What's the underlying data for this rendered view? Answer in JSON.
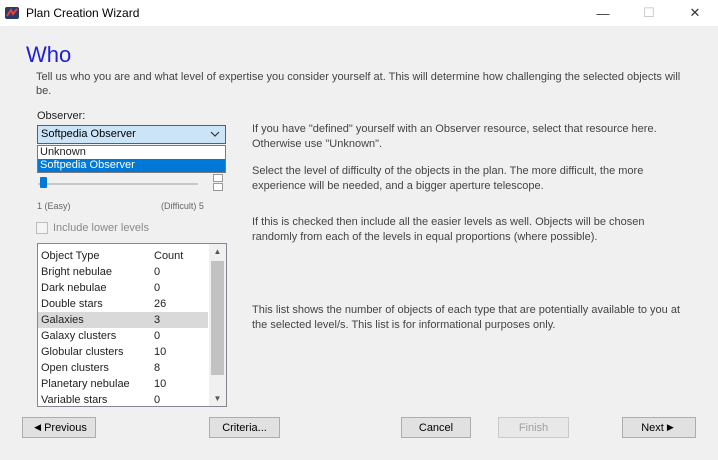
{
  "window": {
    "title": "Plan Creation Wizard",
    "minimize": "—",
    "maximize": "☐",
    "close": "✕"
  },
  "page": {
    "heading": "Who",
    "description": "Tell us who you are and what level of expertise you consider yourself at. This will determine how challenging the selected objects will be."
  },
  "observer": {
    "label": "Observer:",
    "selected": "Softpedia Observer",
    "options": [
      "Unknown",
      "Softpedia Observer"
    ],
    "help": "If you have \"defined\" yourself with an Observer resource, select that resource here. Otherwise use \"Unknown\"."
  },
  "difficulty": {
    "min_label": "1 (Easy)",
    "max_label": "(Difficult) 5",
    "value": 1,
    "help": "Select the level of difficulty of the objects in the plan. The more difficult, the more experience will be needed, and a bigger aperture telescope."
  },
  "include_lower": {
    "label": "Include lower levels",
    "checked": false,
    "help": "If this is checked then include all the easier levels as well. Objects will be chosen randomly from each of the levels in equal proportions (where possible)."
  },
  "object_list": {
    "headers": [
      "Object Type",
      "Count"
    ],
    "rows": [
      {
        "type": "Bright nebulae",
        "count": "0"
      },
      {
        "type": "Dark nebulae",
        "count": "0"
      },
      {
        "type": "Double stars",
        "count": "26"
      },
      {
        "type": "Galaxies",
        "count": "3"
      },
      {
        "type": "Galaxy clusters",
        "count": "0"
      },
      {
        "type": "Globular clusters",
        "count": "10"
      },
      {
        "type": "Open clusters",
        "count": "8"
      },
      {
        "type": "Planetary nebulae",
        "count": "10"
      },
      {
        "type": "Variable stars",
        "count": "0"
      }
    ],
    "selected_index": 3,
    "help": "This list shows the number of objects of each type that are potentially available to you at the selected level/s. This list is for informational purposes only."
  },
  "buttons": {
    "previous": "Previous",
    "criteria": "Criteria...",
    "cancel": "Cancel",
    "finish": "Finish",
    "next": "Next"
  }
}
